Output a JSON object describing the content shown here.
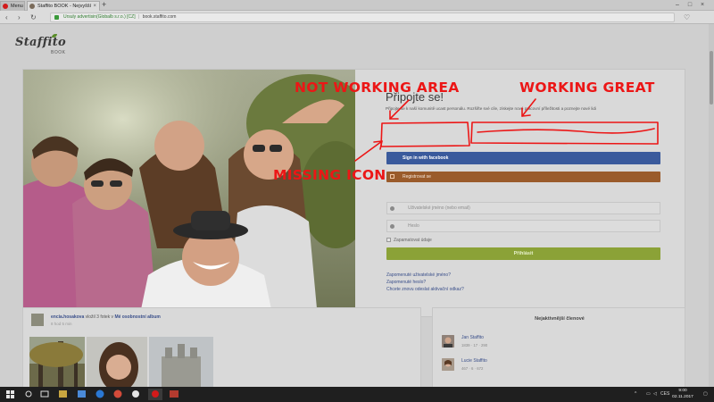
{
  "browser": {
    "tabs": [
      {
        "label": "Menu",
        "color": "#d21a1a"
      },
      {
        "label": "Staffito BOOK - Nejvyšší",
        "color": "#7a6b5a"
      }
    ],
    "address": {
      "secure_label": "Ursuly advertisin(Globalb s.r.o.) [CZ]",
      "domain": "book.staffito.com"
    }
  },
  "logo": {
    "name": "Staffito",
    "sub": "BOOK"
  },
  "login": {
    "title": "Připojte se!",
    "intro": "Připojte se k naší komunitě ucast personálu. Rozšiřte své cíle, získejte nové pracovní příležitosti a poznejte nové lidi",
    "facebook_label": "Sign in with facebook",
    "register_label": "Registrovat se",
    "username_placeholder": "Uživatelské jméno (nebo email)",
    "password_placeholder": "Heslo",
    "remember_label": "Zapamatovat údaje",
    "submit_label": "Přihlásit",
    "links": [
      "Zapomenuté uživatelské jméno?",
      "Zapomenuté heslo?",
      "Chcete znovu odeslat aktivační odkaz?"
    ]
  },
  "annotations": {
    "not_working": "NOT WORKING AREA",
    "working": "WORKING GREAT",
    "missing_icon": "MISSING ICON",
    "color": "#ec1616"
  },
  "feed": {
    "user": "encia.hosakova",
    "action": "vložil 3 fotek v",
    "album": "Mé osobnostní album",
    "time": "8 hod 5 min"
  },
  "members": {
    "title": "Nejaktivnější členové",
    "list": [
      {
        "name": "Jan Staffito",
        "stats": "1839  ·  17  ·  290"
      },
      {
        "name": "Lucie Staffito",
        "stats": "467  ·  6  ·  672"
      }
    ]
  },
  "taskbar": {
    "lang": "CES",
    "time": "9:00",
    "date": "02.11.2017"
  }
}
